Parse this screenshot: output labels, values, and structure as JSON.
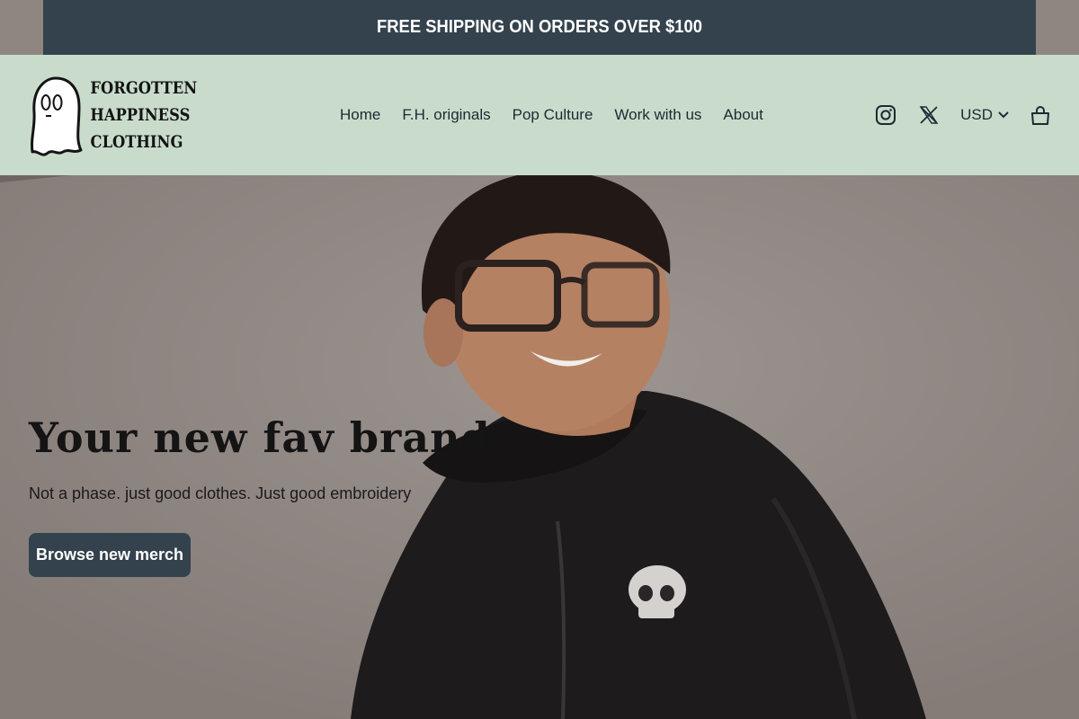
{
  "announcement": {
    "text": "FREE SHIPPING ON ORDERS OVER $100"
  },
  "header": {
    "logo": {
      "lines": [
        "FORGOTTEN",
        "HAPPINESS",
        "CLOTHING"
      ],
      "icon": "ghost-icon"
    },
    "nav": [
      {
        "label": "Home"
      },
      {
        "label": "F.H. originals"
      },
      {
        "label": "Pop Culture"
      },
      {
        "label": "Work with us"
      },
      {
        "label": "About"
      }
    ],
    "icons": {
      "instagram": "instagram-icon",
      "x": "x-icon",
      "cart": "cart-icon"
    },
    "currency": {
      "value": "USD",
      "icon": "chevron-down-icon"
    }
  },
  "hero": {
    "title": "Your new fav brand",
    "subtitle": "Not a phase. just good clothes. Just good embroidery",
    "button_label": "Browse new merch"
  },
  "colors": {
    "announcement_bg": "#33424d",
    "header_bg": "#c9dccc",
    "button_bg": "#33424d",
    "text_dark": "#1d2a33"
  }
}
